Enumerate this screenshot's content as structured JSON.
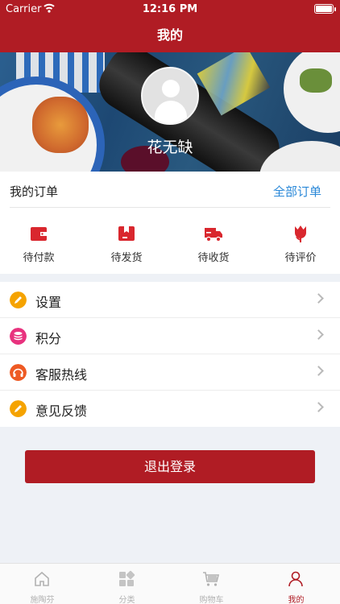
{
  "status_bar": {
    "carrier": "Carrier",
    "time": "12:16 PM"
  },
  "nav": {
    "title": "我的"
  },
  "profile": {
    "username": "花无缺"
  },
  "orders": {
    "title": "我的订单",
    "all_label": "全部订单",
    "items": [
      {
        "label": "待付款",
        "icon": "wallet-icon"
      },
      {
        "label": "待发货",
        "icon": "package-icon"
      },
      {
        "label": "待收货",
        "icon": "truck-icon"
      },
      {
        "label": "待评价",
        "icon": "tulip-icon"
      }
    ]
  },
  "menu": [
    {
      "label": "设置",
      "icon": "pencil-icon",
      "color": "#f5a300"
    },
    {
      "label": "积分",
      "icon": "database-icon",
      "color": "#e8327e"
    },
    {
      "label": "客服热线",
      "icon": "headphones-icon",
      "color": "#ee5a24"
    },
    {
      "label": "意见反馈",
      "icon": "pencil-icon",
      "color": "#f5a300"
    }
  ],
  "logout_label": "退出登录",
  "tabs": [
    {
      "label": "施陶芬",
      "icon": "home-icon"
    },
    {
      "label": "分类",
      "icon": "grid-icon"
    },
    {
      "label": "购物车",
      "icon": "cart-icon"
    },
    {
      "label": "我的",
      "icon": "person-icon",
      "active": true
    }
  ],
  "colors": {
    "brand": "#b01c24",
    "link": "#2a88d8",
    "background": "#eef1f6"
  }
}
